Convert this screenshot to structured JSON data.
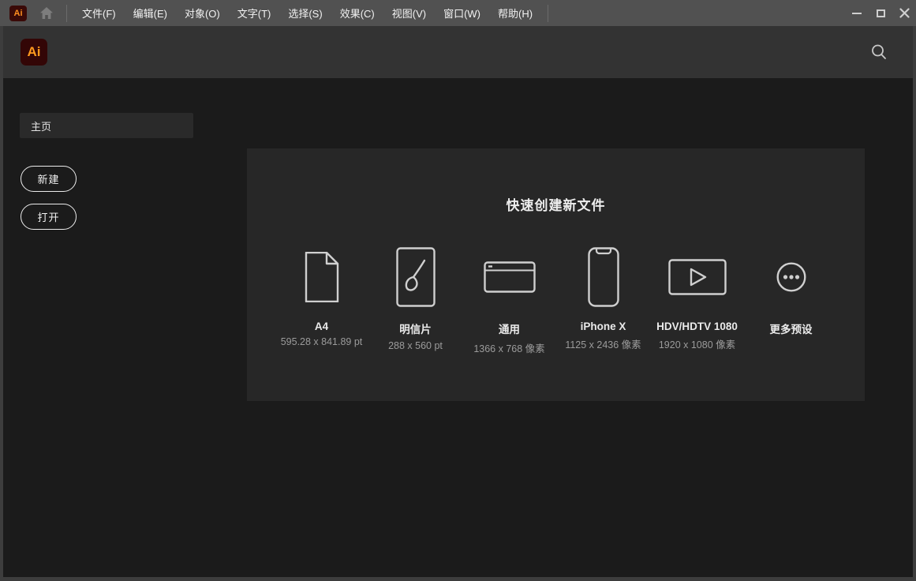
{
  "titlebar": {
    "app_badge": "Ai",
    "menus": [
      {
        "label": "文件(F)"
      },
      {
        "label": "编辑(E)"
      },
      {
        "label": "对象(O)"
      },
      {
        "label": "文字(T)"
      },
      {
        "label": "选择(S)"
      },
      {
        "label": "效果(C)"
      },
      {
        "label": "视图(V)"
      },
      {
        "label": "窗口(W)"
      },
      {
        "label": "帮助(H)"
      }
    ],
    "window_controls": [
      "minimize",
      "maximize",
      "close"
    ]
  },
  "header": {
    "logo_text": "Ai",
    "search_icon": "magnifier"
  },
  "sidebar": {
    "active_item": "主页",
    "new_button": "新建",
    "open_button": "打开"
  },
  "quick_start": {
    "title": "快速创建新文件",
    "presets": [
      {
        "name": "A4",
        "size": "595.28 x 841.89 pt",
        "icon": "document-icon"
      },
      {
        "name": "明信片",
        "size": "288 x 560 pt",
        "icon": "postcard-brush-icon"
      },
      {
        "name": "通用",
        "size": "1366 x 768 像素",
        "icon": "browser-window-icon"
      },
      {
        "name": "iPhone X",
        "size": "1125 x 2436 像素",
        "icon": "phone-icon"
      },
      {
        "name": "HDV/HDTV 1080",
        "size": "1920 x 1080 像素",
        "icon": "video-play-icon"
      },
      {
        "name": "更多预设",
        "size": "",
        "icon": "more-ellipsis-icon"
      }
    ]
  },
  "colors": {
    "titlebar_bg": "#515151",
    "header_bg": "#333333",
    "main_bg": "#1b1b1b",
    "panel_bg": "#272727",
    "brand_tile_bg": "#330606",
    "brand_text": "#ff9a1e",
    "icon_stroke": "#cfcfcf",
    "frame": "#3d3d3d"
  }
}
